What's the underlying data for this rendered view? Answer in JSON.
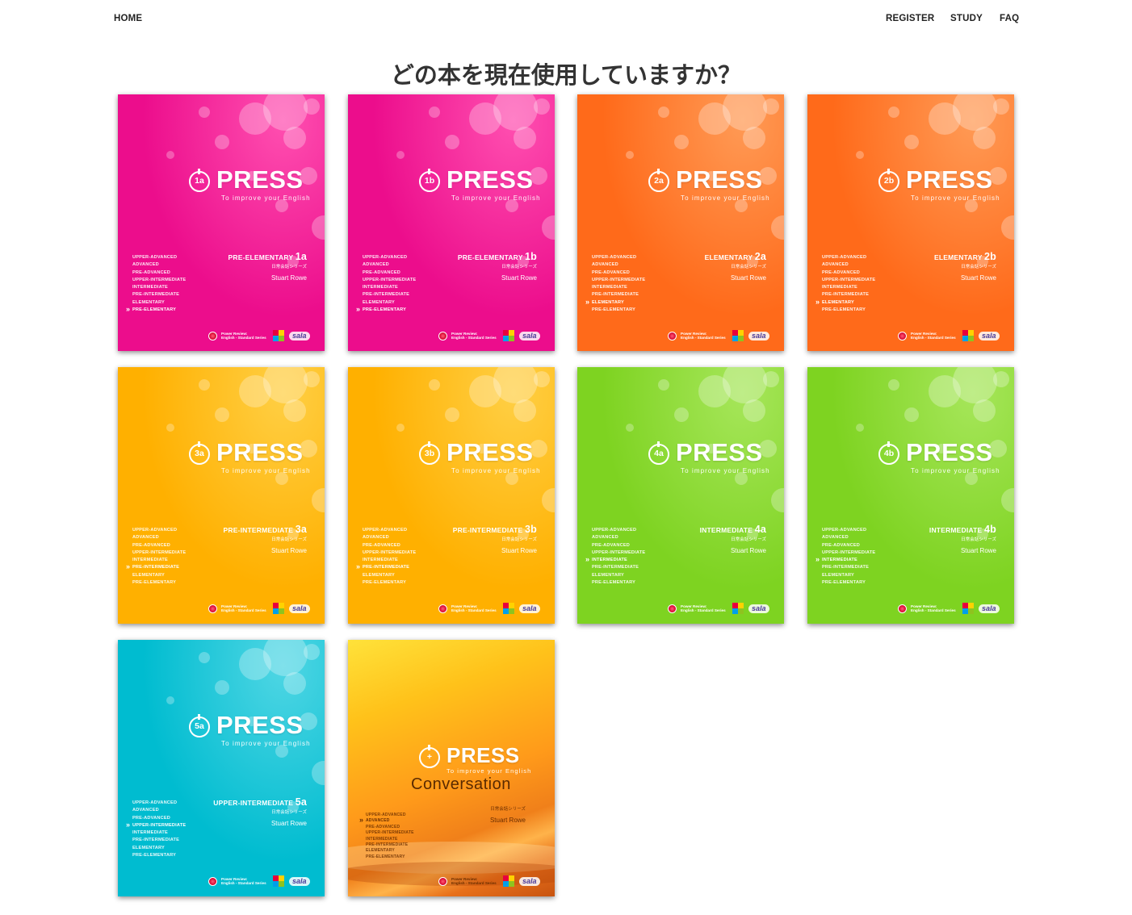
{
  "nav": {
    "home": "HOME",
    "register": "REGISTER",
    "study": "STUDY",
    "faq": "FAQ"
  },
  "page_title": "どの本を現在使用していますか？",
  "common": {
    "brand": "PRESS",
    "tagline": "To improve your English",
    "series": "日常会話シリーズ",
    "author": "Stuart Rowe",
    "publisher_line1": "Power Review:",
    "publisher_line2": "English - Standard Series",
    "sala": "sala",
    "levels": [
      "UPPER-ADVANCED",
      "ADVANCED",
      "PRE-ADVANCED",
      "UPPER-INTERMEDIATE",
      "INTERMEDIATE",
      "PRE-INTERMEDIATE",
      "ELEMENTARY",
      "PRE-ELEMENTARY"
    ]
  },
  "books": [
    {
      "code": "1a",
      "level_name": "PRE-ELEMENTARY",
      "current": 7,
      "color": "#ec0d8c",
      "color2": "#ff4fb0"
    },
    {
      "code": "1b",
      "level_name": "PRE-ELEMENTARY",
      "current": 7,
      "color": "#ec0d8c",
      "color2": "#ff4fb0"
    },
    {
      "code": "2a",
      "level_name": "ELEMENTARY",
      "current": 6,
      "color": "#ff6a1a",
      "color2": "#ff9a55"
    },
    {
      "code": "2b",
      "level_name": "ELEMENTARY",
      "current": 6,
      "color": "#ff6a1a",
      "color2": "#ff9a55"
    },
    {
      "code": "3a",
      "level_name": "PRE-INTERMEDIATE",
      "current": 5,
      "color": "#ffb000",
      "color2": "#ffcf44"
    },
    {
      "code": "3b",
      "level_name": "PRE-INTERMEDIATE",
      "current": 5,
      "color": "#ffb000",
      "color2": "#ffcf44"
    },
    {
      "code": "4a",
      "level_name": "INTERMEDIATE",
      "current": 4,
      "color": "#7ed321",
      "color2": "#a6e65a"
    },
    {
      "code": "4b",
      "level_name": "INTERMEDIATE",
      "current": 4,
      "color": "#7ed321",
      "color2": "#a6e65a"
    },
    {
      "code": "5a",
      "level_name": "UPPER-INTERMEDIATE",
      "current": 3,
      "color": "#00bcd0",
      "color2": "#4fd6e4"
    }
  ],
  "conversation": {
    "brand": "PRESS",
    "tagline": "To improve your English",
    "title": "Conversation",
    "series": "日常会話シリーズ",
    "author": "Stuart Rowe",
    "current": 1
  }
}
